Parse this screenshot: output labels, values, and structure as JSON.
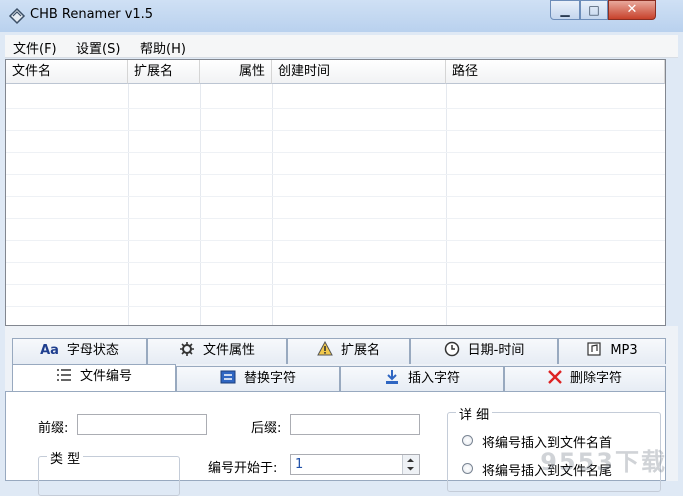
{
  "window": {
    "title": "CHB Renamer v1.5",
    "min_glyph": "▁",
    "max_glyph": "□",
    "close_glyph": "✕"
  },
  "menu": [
    "文件(F)",
    "设置(S)",
    "帮助(H)"
  ],
  "list": {
    "columns": [
      "文件名",
      "扩展名",
      "属性",
      "创建时间",
      "路径"
    ]
  },
  "tabs_row1": [
    {
      "label": "字母状态",
      "icon": "Aa"
    },
    {
      "label": "文件属性",
      "icon": "gear-icon"
    },
    {
      "label": "扩展名",
      "icon": "warning-icon"
    },
    {
      "label": "日期-时间",
      "icon": "clock-icon"
    },
    {
      "label": "MP3",
      "icon": "music-icon"
    }
  ],
  "tabs_row2": [
    {
      "label": "文件编号",
      "icon": "list-icon",
      "active": true
    },
    {
      "label": "替换字符",
      "icon": "replace-icon"
    },
    {
      "label": "插入字符",
      "icon": "insert-icon"
    },
    {
      "label": "删除字符",
      "icon": "delete-icon"
    }
  ],
  "numbering": {
    "prefix_label": "前缀:",
    "prefix_value": "",
    "suffix_label": "后缀:",
    "suffix_value": "",
    "start_label": "编号开始于:",
    "start_value": "1",
    "type_group": "类 型",
    "detail_group": "详 细",
    "detail_options": [
      "将编号插入到文件名首",
      "将编号插入到文件名尾"
    ]
  },
  "watermark": "9553下载"
}
